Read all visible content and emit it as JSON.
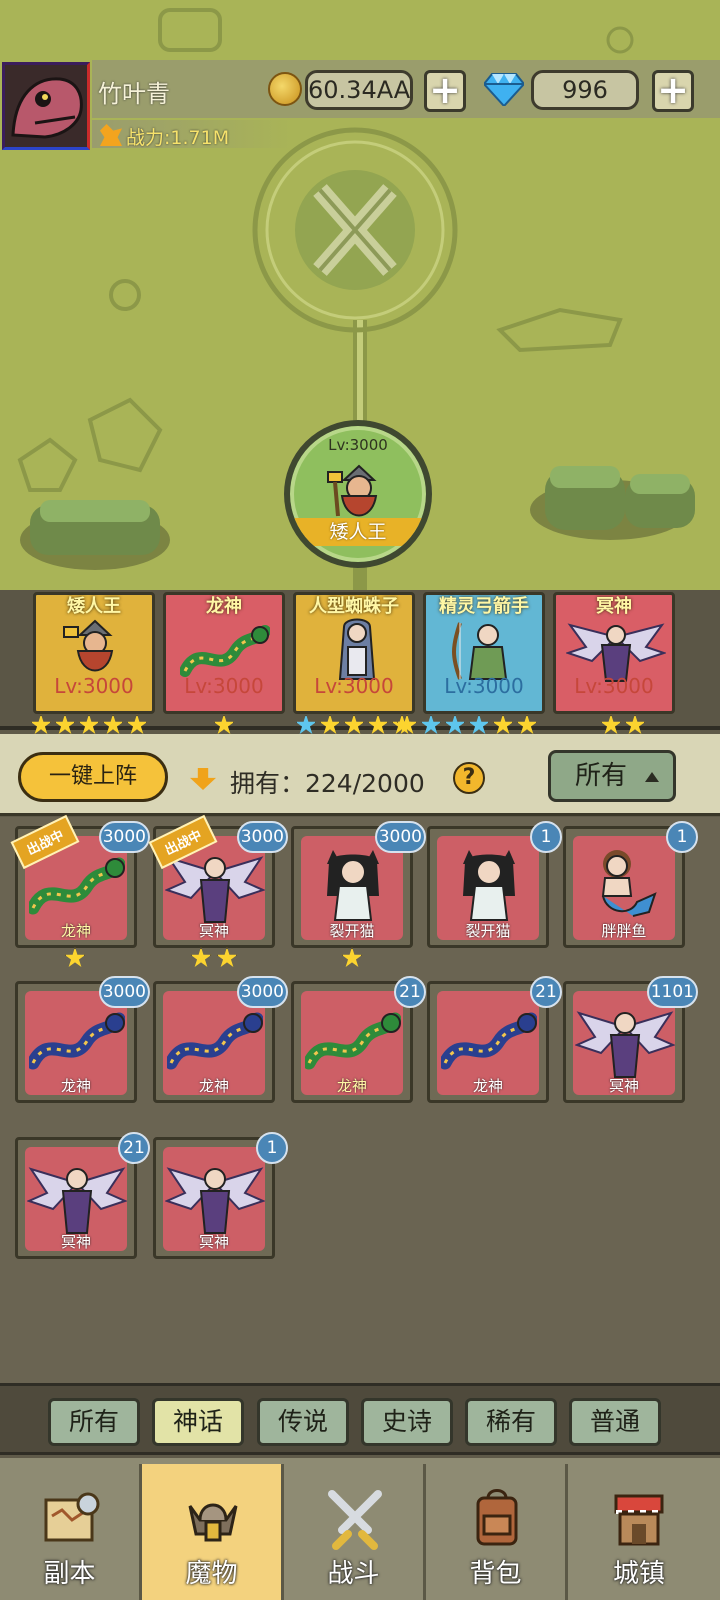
{
  "header": {
    "player_name": "竹叶青",
    "power": "战力:1.71M",
    "gold": "60.34AA",
    "gems": "996",
    "coin_icon": "gold-coin-icon",
    "gem_icon": "diamond-icon",
    "plus_label": "+"
  },
  "hero": {
    "name": "矮人王",
    "level": "Lv:3000"
  },
  "team": [
    {
      "name": "矮人王",
      "level": "Lv:3000",
      "color": "#e0b23c",
      "level_color": "red",
      "stars": [
        "gold",
        "gold",
        "gold",
        "gold",
        "gold"
      ]
    },
    {
      "name": "龙神",
      "level": "Lv:3000",
      "color": "#d95e66",
      "level_color": "red",
      "stars": [
        "gold"
      ]
    },
    {
      "name": "人型蜘蛛子",
      "level": "Lv:3000",
      "color": "#e0b23c",
      "level_color": "red",
      "stars": [
        "blue",
        "gold",
        "gold",
        "gold",
        "gold"
      ]
    },
    {
      "name": "精灵弓箭手",
      "level": "Lv:3000",
      "color": "#62b7d4",
      "level_color": "blue",
      "stars": [
        "gold",
        "blue",
        "blue",
        "blue",
        "gold",
        "gold"
      ]
    },
    {
      "name": "冥神",
      "level": "Lv:3000",
      "color": "#d95e66",
      "level_color": "red",
      "stars": [
        "gold",
        "gold"
      ]
    }
  ],
  "toolbar": {
    "deploy_label": "一键上阵",
    "own_label": "拥有：224/2000",
    "help_label": "?",
    "filter_label": "所有"
  },
  "monsters": [
    {
      "name": "龙神",
      "level": "3000",
      "badge": "出战中",
      "stars": 1,
      "name_color": "#fff7a5"
    },
    {
      "name": "冥神",
      "level": "3000",
      "badge": "出战中",
      "stars": 2,
      "name_color": "#ffffff"
    },
    {
      "name": "裂开猫",
      "level": "3000",
      "badge": "",
      "stars": 1,
      "name_color": "#ffffff"
    },
    {
      "name": "裂开猫",
      "level": "1",
      "badge": "",
      "stars": 0,
      "name_color": "#ffffff"
    },
    {
      "name": "胖胖鱼",
      "level": "1",
      "badge": "",
      "stars": 0,
      "name_color": "#ffffff"
    },
    {
      "name": "龙神",
      "level": "3000",
      "badge": "",
      "stars": 0,
      "name_color": "#ffffff"
    },
    {
      "name": "龙神",
      "level": "3000",
      "badge": "",
      "stars": 0,
      "name_color": "#ffffff"
    },
    {
      "name": "龙神",
      "level": "21",
      "badge": "",
      "stars": 0,
      "name_color": "#fff7a5"
    },
    {
      "name": "龙神",
      "level": "21",
      "badge": "",
      "stars": 0,
      "name_color": "#ffffff"
    },
    {
      "name": "冥神",
      "level": "1101",
      "badge": "",
      "stars": 0,
      "name_color": "#ffffff"
    },
    {
      "name": "冥神",
      "level": "21",
      "badge": "",
      "stars": 0,
      "name_color": "#ffffff"
    },
    {
      "name": "冥神",
      "level": "1",
      "badge": "",
      "stars": 0,
      "name_color": "#ffffff"
    }
  ],
  "categories": [
    {
      "label": "所有",
      "active": false
    },
    {
      "label": "神话",
      "active": true
    },
    {
      "label": "传说",
      "active": false
    },
    {
      "label": "史诗",
      "active": false
    },
    {
      "label": "稀有",
      "active": false
    },
    {
      "label": "普通",
      "active": false
    }
  ],
  "nav": [
    {
      "label": "副本",
      "icon": "map-scroll-icon",
      "active": false
    },
    {
      "label": "魔物",
      "icon": "horned-helmet-icon",
      "active": true
    },
    {
      "label": "战斗",
      "icon": "crossed-swords-icon",
      "active": false
    },
    {
      "label": "背包",
      "icon": "backpack-icon",
      "active": false
    },
    {
      "label": "城镇",
      "icon": "shop-house-icon",
      "active": false
    }
  ]
}
